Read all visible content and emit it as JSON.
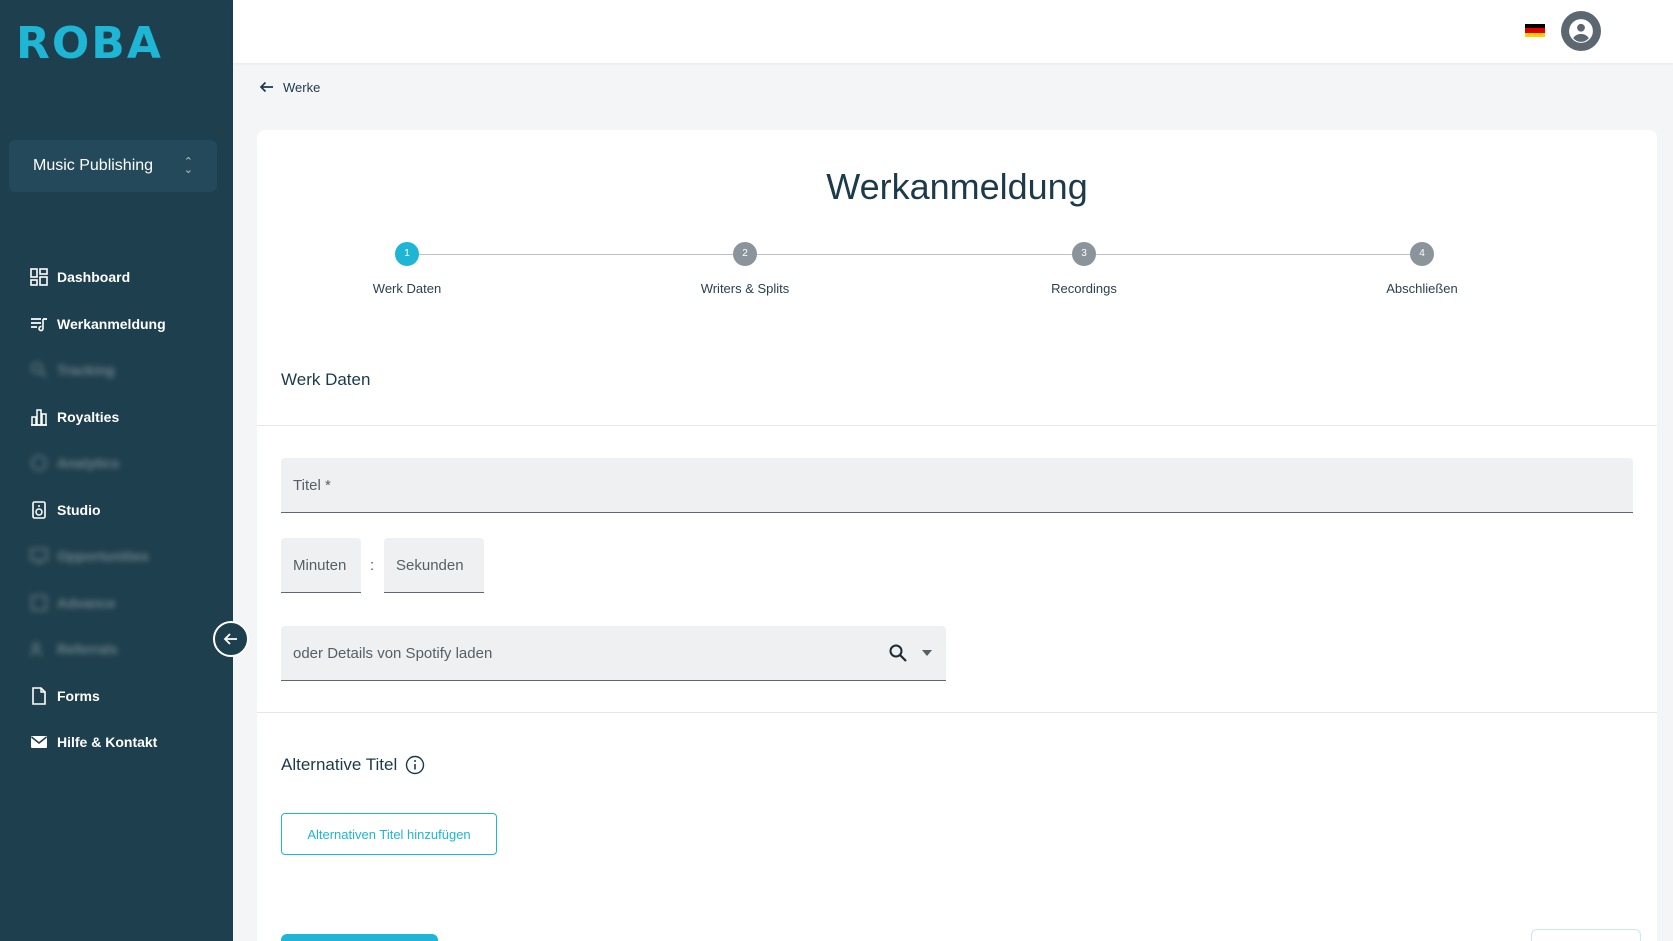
{
  "sidebar": {
    "logo": "ROBA",
    "org_select": "Music Publishing",
    "items": [
      {
        "label": "Dashboard",
        "icon": "dashboard-icon"
      },
      {
        "label": "Werkanmeldung",
        "icon": "music-list-icon"
      },
      {
        "label": "Tracking",
        "icon": "search-icon"
      },
      {
        "label": "Royalties",
        "icon": "bar-chart-icon"
      },
      {
        "label": "Analytics",
        "icon": "analytics-icon"
      },
      {
        "label": "Studio",
        "icon": "speaker-icon"
      },
      {
        "label": "Opportunities",
        "icon": "monitor-icon"
      },
      {
        "label": "Advance",
        "icon": "advance-icon"
      },
      {
        "label": "Referrals",
        "icon": "referral-icon"
      },
      {
        "label": "Forms",
        "icon": "document-icon"
      },
      {
        "label": "Hilfe & Kontakt",
        "icon": "mail-icon"
      }
    ]
  },
  "breadcrumb": {
    "label": "Werke"
  },
  "page": {
    "title": "Werkanmeldung",
    "steps": [
      {
        "number": "1",
        "label": "Werk Daten",
        "active": true
      },
      {
        "number": "2",
        "label": "Writers & Splits",
        "active": false
      },
      {
        "number": "3",
        "label": "Recordings",
        "active": false
      },
      {
        "number": "4",
        "label": "Abschließen",
        "active": false
      }
    ],
    "section_title": "Werk Daten",
    "fields": {
      "title_placeholder": "Titel *",
      "minutes_placeholder": "Minuten",
      "colon": ":",
      "seconds_placeholder": "Sekunden",
      "spotify_placeholder": "oder Details von Spotify laden"
    },
    "alt_title_heading": "Alternative Titel",
    "add_alt_title_button": "Alternativen Titel hinzufügen"
  },
  "colors": {
    "sidebar_bg": "#1e3f4d",
    "accent": "#1fb5d4",
    "text_dark": "#1c3a4a"
  }
}
